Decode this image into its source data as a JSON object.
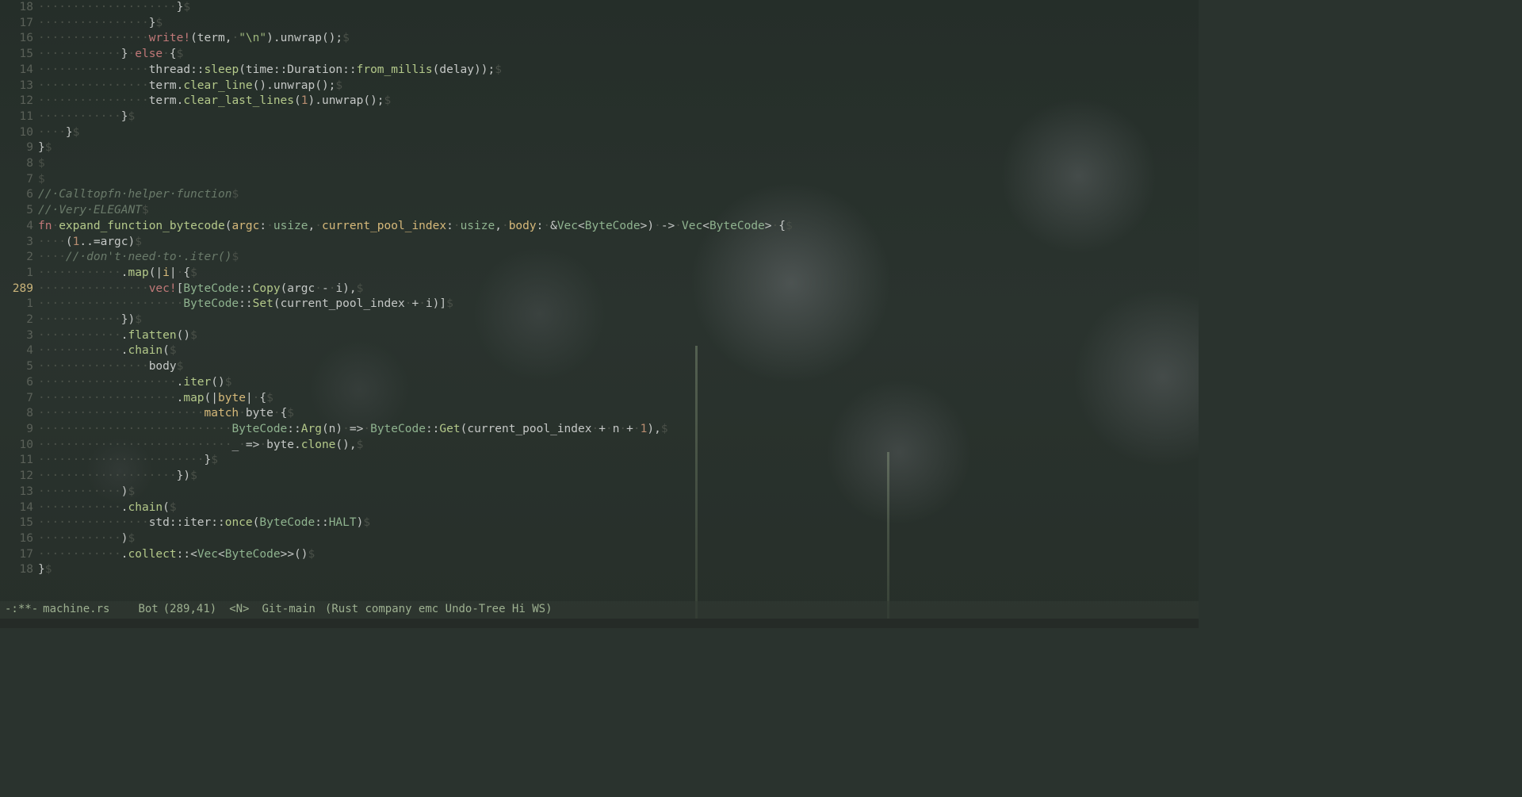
{
  "modeline": {
    "modified": "-:**-",
    "buffer": "machine.rs",
    "position": "Bot",
    "linecol": "(289,41)",
    "state": "<N>",
    "vcs": "Git-main",
    "modes": "(Rust company emc Undo-Tree Hi WS)"
  },
  "cursor_line_abs": "289",
  "lines": [
    {
      "rel": "18",
      "t": [
        [
          "ws",
          "····················"
        ],
        [
          "op",
          "}"
        ],
        [
          "eol",
          "$"
        ]
      ]
    },
    {
      "rel": "17",
      "t": [
        [
          "ws",
          "················"
        ],
        [
          "op",
          "}"
        ],
        [
          "eol",
          "$"
        ]
      ]
    },
    {
      "rel": "16",
      "t": [
        [
          "ws",
          "················"
        ],
        [
          "macro",
          "write!"
        ],
        [
          "op",
          "(term,"
        ],
        [
          "ws",
          "·"
        ],
        [
          "str",
          "\"\\n\""
        ],
        [
          "op",
          ").unwrap();"
        ],
        [
          "eol",
          "$"
        ]
      ]
    },
    {
      "rel": "15",
      "t": [
        [
          "ws",
          "············"
        ],
        [
          "op",
          "}"
        ],
        [
          "ws",
          "·"
        ],
        [
          "kw",
          "else"
        ],
        [
          "ws",
          "·"
        ],
        [
          "op",
          "{"
        ],
        [
          "eol",
          "$"
        ]
      ]
    },
    {
      "rel": "14",
      "t": [
        [
          "ws",
          "················"
        ],
        [
          "pathns",
          "thread::"
        ],
        [
          "fn",
          "sleep"
        ],
        [
          "op",
          "("
        ],
        [
          "pathns",
          "time::Duration::"
        ],
        [
          "fn",
          "from_millis"
        ],
        [
          "op",
          "(delay));"
        ],
        [
          "eol",
          "$"
        ]
      ]
    },
    {
      "rel": "13",
      "t": [
        [
          "ws",
          "················"
        ],
        [
          "op",
          "term."
        ],
        [
          "fn",
          "clear_line"
        ],
        [
          "op",
          "().unwrap();"
        ],
        [
          "eol",
          "$"
        ]
      ]
    },
    {
      "rel": "12",
      "t": [
        [
          "ws",
          "················"
        ],
        [
          "op",
          "term."
        ],
        [
          "fn",
          "clear_last_lines"
        ],
        [
          "op",
          "("
        ],
        [
          "num",
          "1"
        ],
        [
          "op",
          ").unwrap();"
        ],
        [
          "eol",
          "$"
        ]
      ]
    },
    {
      "rel": "11",
      "t": [
        [
          "ws",
          "············"
        ],
        [
          "op",
          "}"
        ],
        [
          "eol",
          "$"
        ]
      ]
    },
    {
      "rel": "10",
      "t": [
        [
          "ws",
          "····"
        ],
        [
          "op",
          "}"
        ],
        [
          "eol",
          "$"
        ]
      ]
    },
    {
      "rel": "9",
      "t": [
        [
          "op",
          "}"
        ],
        [
          "eol",
          "$"
        ]
      ]
    },
    {
      "rel": "8",
      "t": [
        [
          "eol",
          "$"
        ]
      ]
    },
    {
      "rel": "7",
      "t": [
        [
          "eol",
          "$"
        ]
      ]
    },
    {
      "rel": "6",
      "t": [
        [
          "comment",
          "//·Calltopfn·helper·function"
        ],
        [
          "eol",
          "$"
        ]
      ]
    },
    {
      "rel": "5",
      "t": [
        [
          "comment",
          "//·Very·ELEGANT"
        ],
        [
          "eol",
          "$"
        ]
      ]
    },
    {
      "rel": "4",
      "t": [
        [
          "kw",
          "fn"
        ],
        [
          "ws",
          "·"
        ],
        [
          "fn",
          "expand_function_bytecode"
        ],
        [
          "op",
          "("
        ],
        [
          "param",
          "argc"
        ],
        [
          "op",
          ":"
        ],
        [
          "ws",
          "·"
        ],
        [
          "type",
          "usize"
        ],
        [
          "op",
          ","
        ],
        [
          "ws",
          "·"
        ],
        [
          "param",
          "current_pool_index"
        ],
        [
          "op",
          ":"
        ],
        [
          "ws",
          "·"
        ],
        [
          "type",
          "usize"
        ],
        [
          "op",
          ","
        ],
        [
          "ws",
          "·"
        ],
        [
          "param",
          "body"
        ],
        [
          "op",
          ":"
        ],
        [
          "ws",
          "·"
        ],
        [
          "op",
          "&"
        ],
        [
          "type",
          "Vec"
        ],
        [
          "op",
          "<"
        ],
        [
          "type",
          "ByteCode"
        ],
        [
          "op",
          ">)"
        ],
        [
          "ws",
          "·"
        ],
        [
          "op",
          "->"
        ],
        [
          "ws",
          "·"
        ],
        [
          "type",
          "Vec"
        ],
        [
          "op",
          "<"
        ],
        [
          "type",
          "ByteCode"
        ],
        [
          "op",
          ">"
        ],
        [
          "ws",
          "·"
        ],
        [
          "op",
          "{"
        ],
        [
          "eol",
          "$"
        ]
      ]
    },
    {
      "rel": "3",
      "t": [
        [
          "ws",
          "····"
        ],
        [
          "op",
          "("
        ],
        [
          "num",
          "1"
        ],
        [
          "op",
          "..="
        ],
        [
          "op",
          "argc)"
        ],
        [
          "eol",
          "$"
        ]
      ]
    },
    {
      "rel": "2",
      "t": [
        [
          "ws",
          "····"
        ],
        [
          "comment",
          "//·don't·need·to·.iter()"
        ],
        [
          "eol",
          "$"
        ]
      ]
    },
    {
      "rel": "1",
      "t": [
        [
          "ws",
          "············"
        ],
        [
          "op",
          "."
        ],
        [
          "fn",
          "map"
        ],
        [
          "op",
          "(|"
        ],
        [
          "param",
          "i"
        ],
        [
          "op",
          "|"
        ],
        [
          "ws",
          "·"
        ],
        [
          "op",
          "{"
        ],
        [
          "eol",
          "$"
        ]
      ]
    },
    {
      "rel": "289",
      "cur": true,
      "t": [
        [
          "ws",
          "················"
        ],
        [
          "macro",
          "vec!"
        ],
        [
          "op",
          "["
        ],
        [
          "type",
          "ByteCode"
        ],
        [
          "op",
          "::"
        ],
        [
          "fn",
          "Copy"
        ],
        [
          "op",
          "(argc"
        ],
        [
          "ws",
          "·"
        ],
        [
          "op",
          "-"
        ],
        [
          "ws",
          "·"
        ],
        [
          "op",
          "i),"
        ],
        [
          "eol",
          "$"
        ]
      ]
    },
    {
      "rel": "1",
      "t": [
        [
          "ws",
          "·····················"
        ],
        [
          "type",
          "ByteCode"
        ],
        [
          "op",
          "::"
        ],
        [
          "fn",
          "Set"
        ],
        [
          "op",
          "(current_pool_index"
        ],
        [
          "ws",
          "·"
        ],
        [
          "op",
          "+"
        ],
        [
          "ws",
          "·"
        ],
        [
          "op",
          "i)]"
        ],
        [
          "eol",
          "$"
        ]
      ]
    },
    {
      "rel": "2",
      "t": [
        [
          "ws",
          "············"
        ],
        [
          "op",
          "})"
        ],
        [
          "eol",
          "$"
        ]
      ]
    },
    {
      "rel": "3",
      "t": [
        [
          "ws",
          "············"
        ],
        [
          "op",
          "."
        ],
        [
          "fn",
          "flatten"
        ],
        [
          "op",
          "()"
        ],
        [
          "eol",
          "$"
        ]
      ]
    },
    {
      "rel": "4",
      "t": [
        [
          "ws",
          "············"
        ],
        [
          "op",
          "."
        ],
        [
          "fn",
          "chain"
        ],
        [
          "op",
          "("
        ],
        [
          "eol",
          "$"
        ]
      ]
    },
    {
      "rel": "5",
      "t": [
        [
          "ws",
          "················"
        ],
        [
          "op",
          "body"
        ],
        [
          "eol",
          "$"
        ]
      ]
    },
    {
      "rel": "6",
      "t": [
        [
          "ws",
          "····················"
        ],
        [
          "op",
          "."
        ],
        [
          "fn",
          "iter"
        ],
        [
          "op",
          "()"
        ],
        [
          "eol",
          "$"
        ]
      ]
    },
    {
      "rel": "7",
      "t": [
        [
          "ws",
          "····················"
        ],
        [
          "op",
          "."
        ],
        [
          "fn",
          "map"
        ],
        [
          "op",
          "(|"
        ],
        [
          "param",
          "byte"
        ],
        [
          "op",
          "|"
        ],
        [
          "ws",
          "·"
        ],
        [
          "op",
          "{"
        ],
        [
          "eol",
          "$"
        ]
      ]
    },
    {
      "rel": "8",
      "t": [
        [
          "ws",
          "························"
        ],
        [
          "kw2",
          "match"
        ],
        [
          "ws",
          "·"
        ],
        [
          "op",
          "byte"
        ],
        [
          "ws",
          "·"
        ],
        [
          "op",
          "{"
        ],
        [
          "eol",
          "$"
        ]
      ]
    },
    {
      "rel": "9",
      "t": [
        [
          "ws",
          "····························"
        ],
        [
          "type",
          "ByteCode"
        ],
        [
          "op",
          "::"
        ],
        [
          "fn",
          "Arg"
        ],
        [
          "op",
          "(n)"
        ],
        [
          "ws",
          "·"
        ],
        [
          "op",
          "=>"
        ],
        [
          "ws",
          "·"
        ],
        [
          "type",
          "ByteCode"
        ],
        [
          "op",
          "::"
        ],
        [
          "fn",
          "Get"
        ],
        [
          "op",
          "(current_pool_index"
        ],
        [
          "ws",
          "·"
        ],
        [
          "op",
          "+"
        ],
        [
          "ws",
          "·"
        ],
        [
          "op",
          "n"
        ],
        [
          "ws",
          "·"
        ],
        [
          "op",
          "+"
        ],
        [
          "ws",
          "·"
        ],
        [
          "num",
          "1"
        ],
        [
          "op",
          "),"
        ],
        [
          "eol",
          "$"
        ]
      ]
    },
    {
      "rel": "10",
      "t": [
        [
          "ws",
          "····························"
        ],
        [
          "op",
          "_"
        ],
        [
          "ws",
          "·"
        ],
        [
          "op",
          "=>"
        ],
        [
          "ws",
          "·"
        ],
        [
          "op",
          "byte."
        ],
        [
          "fn",
          "clone"
        ],
        [
          "op",
          "(),"
        ],
        [
          "eol",
          "$"
        ]
      ]
    },
    {
      "rel": "11",
      "t": [
        [
          "ws",
          "························"
        ],
        [
          "op",
          "}"
        ],
        [
          "eol",
          "$"
        ]
      ]
    },
    {
      "rel": "12",
      "t": [
        [
          "ws",
          "····················"
        ],
        [
          "op",
          "})"
        ],
        [
          "eol",
          "$"
        ]
      ]
    },
    {
      "rel": "13",
      "t": [
        [
          "ws",
          "············"
        ],
        [
          "op",
          ")"
        ],
        [
          "eol",
          "$"
        ]
      ]
    },
    {
      "rel": "14",
      "t": [
        [
          "ws",
          "············"
        ],
        [
          "op",
          "."
        ],
        [
          "fn",
          "chain"
        ],
        [
          "op",
          "("
        ],
        [
          "eol",
          "$"
        ]
      ]
    },
    {
      "rel": "15",
      "t": [
        [
          "ws",
          "················"
        ],
        [
          "pathns",
          "std::iter::"
        ],
        [
          "fn",
          "once"
        ],
        [
          "op",
          "("
        ],
        [
          "type",
          "ByteCode"
        ],
        [
          "op",
          "::"
        ],
        [
          "type",
          "HALT"
        ],
        [
          "op",
          ")"
        ],
        [
          "eol",
          "$"
        ]
      ]
    },
    {
      "rel": "16",
      "t": [
        [
          "ws",
          "············"
        ],
        [
          "op",
          ")"
        ],
        [
          "eol",
          "$"
        ]
      ]
    },
    {
      "rel": "17",
      "t": [
        [
          "ws",
          "············"
        ],
        [
          "op",
          "."
        ],
        [
          "fn",
          "collect"
        ],
        [
          "op",
          "::<"
        ],
        [
          "type",
          "Vec"
        ],
        [
          "op",
          "<"
        ],
        [
          "type",
          "ByteCode"
        ],
        [
          "op",
          ">>()"
        ],
        [
          "eol",
          "$"
        ]
      ]
    },
    {
      "rel": "18",
      "t": [
        [
          "op",
          "}"
        ],
        [
          "eol",
          "$"
        ]
      ]
    }
  ]
}
